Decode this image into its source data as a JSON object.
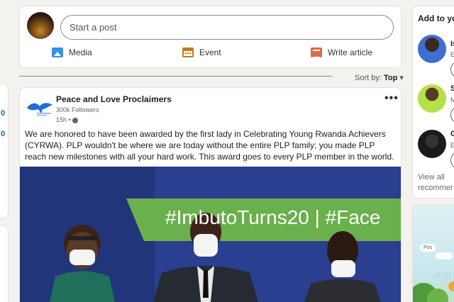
{
  "composer": {
    "placeholder": "Start a post",
    "actions": [
      {
        "label": "Media",
        "icon": "image-icon",
        "color": "#378fe9"
      },
      {
        "label": "Event",
        "icon": "calendar-icon",
        "color": "#c37d16"
      },
      {
        "label": "Write article",
        "icon": "article-icon",
        "color": "#e06847"
      }
    ]
  },
  "feed": {
    "sort_prefix": "Sort by:",
    "sort_value": "Top"
  },
  "post": {
    "author": "Peace and Love Proclaimers",
    "followers": "300k Followers",
    "time": "15h •",
    "text": "We are honored to have been awarded by the first lady in Celebrating Young Rwanda Achievers (CYRWA). PLP wouldn't be where we are today without the entire PLP family; you made PLP reach new milestones with all your hard work. This award goes to every PLP member in the world.",
    "photo_banner_text": "#ImbutoTurns20 | #Face"
  },
  "left_sliver": {
    "numbers": [
      "0",
      "0"
    ]
  },
  "right_rail": {
    "title": "Add to yo",
    "recommendations": [
      {
        "initial": "Is",
        "sub": "E"
      },
      {
        "initial": "S",
        "sub": "M"
      },
      {
        "initial": "G",
        "sub": "E"
      }
    ],
    "view_all": "View all recommer"
  },
  "ad": {
    "chip_1": "Pos",
    "chip_2": "",
    "text": "Acti"
  },
  "colors": {
    "accent": "#0a66c2",
    "page_bg": "#f4f2ee",
    "banner_green": "#6ab04c",
    "banner_blue": "#1f3a86"
  }
}
